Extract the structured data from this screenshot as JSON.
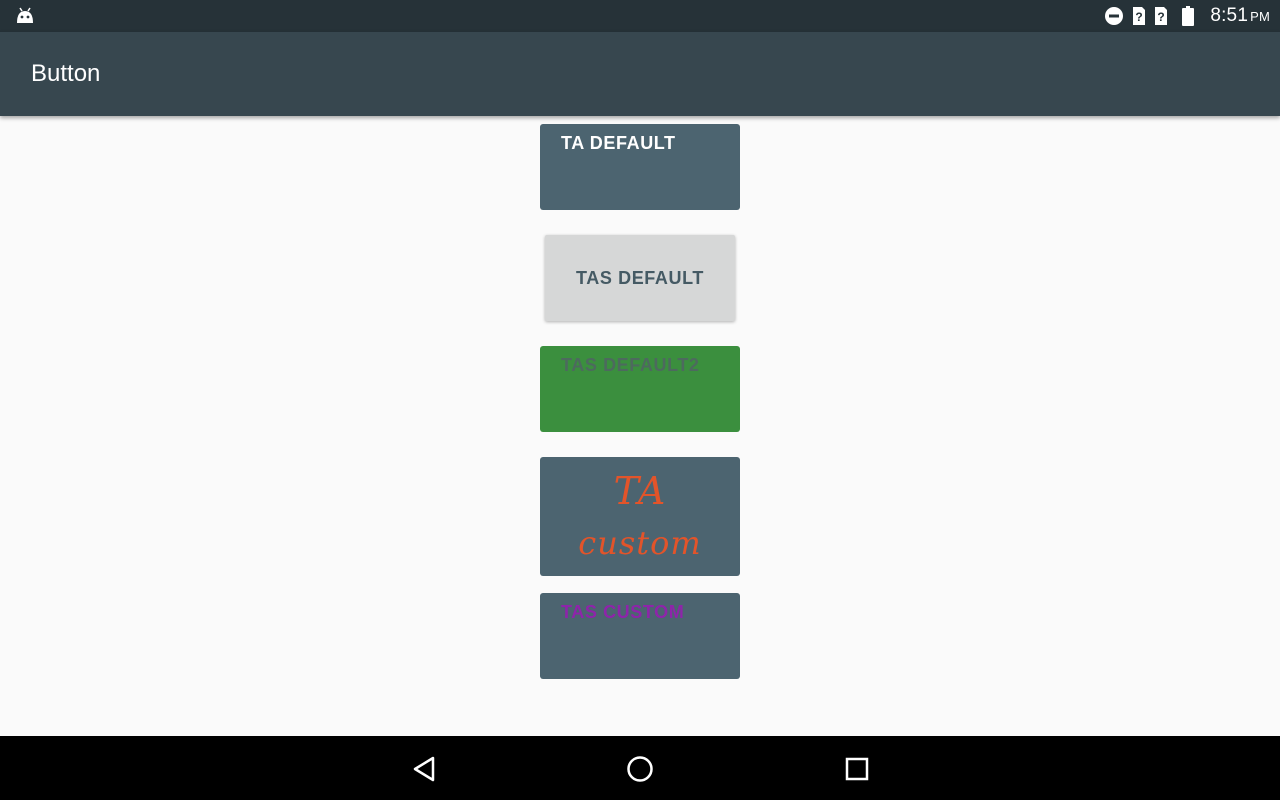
{
  "status_bar": {
    "time": "8:51",
    "ampm": "PM",
    "icons": [
      "android-icon",
      "do-not-disturb-icon",
      "no-sim-icon",
      "no-sim-icon",
      "battery-icon"
    ]
  },
  "app_bar": {
    "title": "Button"
  },
  "buttons": {
    "ta_default": "TA DEFAULT",
    "tas_default": "TAS DEFAULT",
    "tas_default2": "TAS DEFAULT2",
    "ta_custom_line1": "TA",
    "ta_custom_line2": "custom",
    "tas_custom": "TAS CUSTOM"
  },
  "nav_bar": {
    "icons": [
      "back-icon",
      "home-icon",
      "recents-icon"
    ]
  },
  "colors": {
    "status_bar": "#263238",
    "app_bar": "#37474f",
    "button_slate": "#4c6470",
    "button_green": "#3b8f3e",
    "button_grey": "#d6d7d7",
    "custom_text_orange": "#e2542a",
    "custom_text_purple": "#8e24aa"
  }
}
